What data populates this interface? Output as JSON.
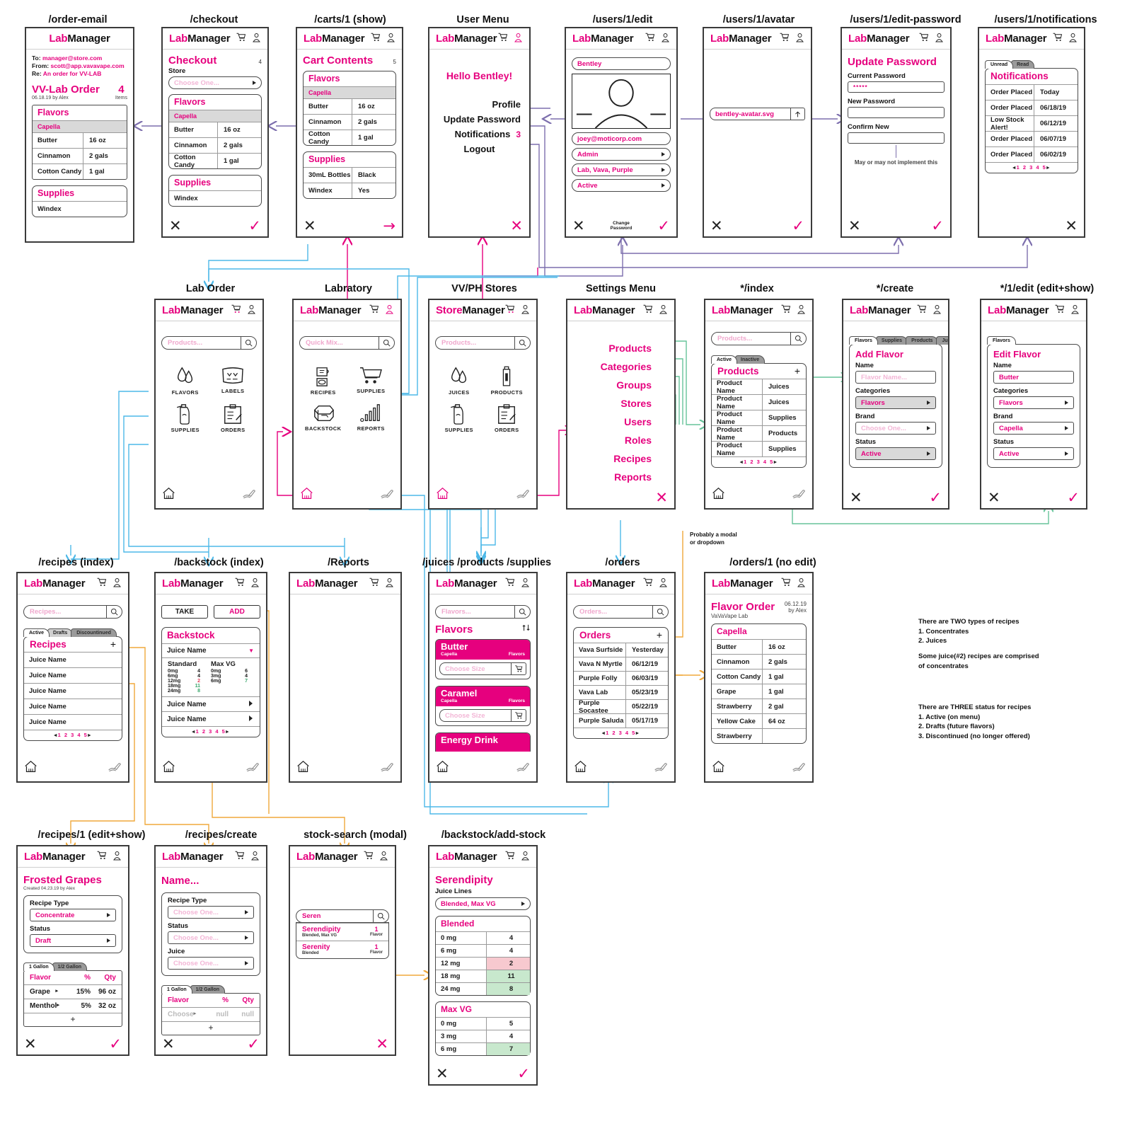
{
  "brand": {
    "pink": "Lab",
    "black": "Manager",
    "store_pink": "Store",
    "store_black": "Manager"
  },
  "colors": {
    "accent": "#e6007e",
    "ink": "#1a1a1a",
    "wire_blue": "#4db8e8",
    "wire_pink": "#e6007e",
    "wire_orange": "#f0a93b",
    "wire_purple": "#7d6fad",
    "wire_green": "#67c39a"
  },
  "screens": {
    "order_email": {
      "title": "/order-email",
      "to_label": "To:",
      "to_value": "manager@store.com",
      "from_label": "From:",
      "from_value": "scott@app.vavavape.com",
      "re_label": "Re:",
      "re_value": "An order for VV-LAB",
      "order_title": "VV-Lab Order",
      "order_count": "4",
      "order_count_label": "Items",
      "order_meta": "06.18.19 by Alex",
      "flavors_header": "Flavors",
      "brand_row": "Capella",
      "flavors": [
        {
          "name": "Butter",
          "qty": "16 oz"
        },
        {
          "name": "Cinnamon",
          "qty": "2 gals"
        },
        {
          "name": "Cotton Candy",
          "qty": "1 gal"
        }
      ],
      "supplies_header": "Supplies",
      "supplies": [
        {
          "name": "Windex",
          "qty": ""
        }
      ]
    },
    "checkout": {
      "title": "/checkout",
      "heading": "Checkout",
      "count": "4",
      "store_label": "Store",
      "store_placeholder": "Choose One...",
      "flavors_header": "Flavors",
      "brand_row": "Capella",
      "flavors": [
        {
          "name": "Butter",
          "qty": "16 oz"
        },
        {
          "name": "Cinnamon",
          "qty": "2 gals"
        },
        {
          "name": "Cotton Candy",
          "qty": "1 gal"
        }
      ],
      "supplies_header": "Supplies",
      "supplies": [
        {
          "name": "Windex",
          "qty": ""
        }
      ],
      "cancel": "✕",
      "confirm": "✓"
    },
    "cart": {
      "title": "/carts/1 (show)",
      "heading": "Cart Contents",
      "count": "5",
      "flavors_header": "Flavors",
      "brand_row": "Capella",
      "flavors": [
        {
          "name": "Butter",
          "qty": "16 oz"
        },
        {
          "name": "Cinnamon",
          "qty": "2 gals"
        },
        {
          "name": "Cotton Candy",
          "qty": "1 gal"
        }
      ],
      "supplies_header": "Supplies",
      "supplies": [
        {
          "name": "30mL Bottles",
          "qty": "Black"
        },
        {
          "name": "Windex",
          "qty": "Yes"
        }
      ],
      "cancel": "✕",
      "next": "→"
    },
    "user_menu": {
      "title": "User Menu",
      "greeting": "Hello Bentley!",
      "items": [
        {
          "label": "Profile",
          "badge": ""
        },
        {
          "label": "Update Password",
          "badge": ""
        },
        {
          "label": "Notifications",
          "badge": "3"
        },
        {
          "label": "Logout",
          "badge": ""
        }
      ],
      "close": "✕"
    },
    "user_edit": {
      "title": "/users/1/edit",
      "name": "Bentley",
      "email": "joey@moticorp.com",
      "role": "Admin",
      "stores": "Lab, Vava, Purple",
      "status": "Active",
      "change_password": "Change\nPassword",
      "cancel": "✕",
      "confirm": "✓"
    },
    "user_avatar": {
      "title": "/users/1/avatar",
      "file": "bentley-avatar.svg",
      "upload_icon": "upload-icon",
      "cancel": "✕",
      "confirm": "✓"
    },
    "edit_password": {
      "title": "/users/1/edit-password",
      "heading": "Update Password",
      "current_label": "Current Password",
      "current_value": "*****",
      "new_label": "New Password",
      "new_value": "",
      "confirm_label": "Confirm New",
      "confirm_value": "",
      "note": "May or may not implement this",
      "cancel": "✕",
      "confirm": "✓"
    },
    "notifications": {
      "title": "/users/1/notifications",
      "tabs": [
        {
          "label": "Unread",
          "active": true
        },
        {
          "label": "Read",
          "active": false
        }
      ],
      "heading": "Notifications",
      "rows": [
        {
          "text": "Order Placed",
          "date": "Today"
        },
        {
          "text": "Order Placed",
          "date": "06/18/19"
        },
        {
          "text": "Low Stock Alert!",
          "date": "06/12/19"
        },
        {
          "text": "Order Placed",
          "date": "06/07/19"
        },
        {
          "text": "Order Placed",
          "date": "06/02/19"
        }
      ],
      "pager": "1 2 3 4 5",
      "close": "✕"
    },
    "lab_order": {
      "title": "Lab Order",
      "search_placeholder": "Products...",
      "tiles": [
        {
          "label": "FLAVORS",
          "icon": "droplets-icon"
        },
        {
          "label": "LABELS",
          "icon": "label-icon"
        },
        {
          "label": "SUPPLIES",
          "icon": "spray-bottle-icon"
        },
        {
          "label": "ORDERS",
          "icon": "clipboard-icon"
        }
      ],
      "home_icon": "home-icon",
      "tools_icon": "tools-icon"
    },
    "labratory": {
      "title": "Labratory",
      "search_placeholder": "Quick Mix...",
      "tiles": [
        {
          "label": "RECIPES",
          "icon": "beaker-icon"
        },
        {
          "label": "SUPPLIES",
          "icon": "cart-icon"
        },
        {
          "label": "BACKSTOCK",
          "icon": "box-icon"
        },
        {
          "label": "REPORTS",
          "icon": "bars-icon"
        }
      ],
      "home_icon": "home-icon",
      "tools_icon": "tools-icon"
    },
    "stores": {
      "title": "VV/PH Stores",
      "search_placeholder": "Products...",
      "tiles": [
        {
          "label": "JUICES",
          "icon": "droplets-icon"
        },
        {
          "label": "PRODUCTS",
          "icon": "bottle-icon"
        },
        {
          "label": "SUPPLIES",
          "icon": "spray-bottle-icon"
        },
        {
          "label": "ORDERS",
          "icon": "clipboard-icon"
        }
      ],
      "home_icon": "home-icon",
      "tools_icon": "tools-icon"
    },
    "settings_menu": {
      "title": "Settings Menu",
      "items": [
        "Products",
        "Categories",
        "Groups",
        "Stores",
        "Users",
        "Roles",
        "Recipes",
        "Reports"
      ],
      "close": "✕"
    },
    "index": {
      "title": "*/index",
      "search_placeholder": "Products...",
      "tabs": [
        {
          "label": "Active",
          "active": true
        },
        {
          "label": "Inactive",
          "active": false
        }
      ],
      "heading": "Products",
      "add": "+",
      "rows": [
        {
          "name": "Product Name",
          "cat": "Juices"
        },
        {
          "name": "Product Name",
          "cat": "Juices"
        },
        {
          "name": "Product Name",
          "cat": "Supplies"
        },
        {
          "name": "Product Name",
          "cat": "Products"
        },
        {
          "name": "Product Name",
          "cat": "Supplies"
        }
      ],
      "pager": "1 2 3 4 5",
      "home_icon": "home-icon",
      "tools_icon": "tools-icon"
    },
    "create": {
      "title": "*/create",
      "tabs": [
        {
          "label": "Flavors",
          "active": true
        },
        {
          "label": "Supplies",
          "active": false
        },
        {
          "label": "Products",
          "active": false
        },
        {
          "label": "Juices",
          "active": false
        }
      ],
      "heading": "Add Flavor",
      "fields": [
        {
          "label": "Name",
          "value": "",
          "placeholder": "Flavor Name...",
          "select": false
        },
        {
          "label": "Categories",
          "value": "Flavors",
          "placeholder": "",
          "select": true
        },
        {
          "label": "Brand",
          "value": "",
          "placeholder": "Choose One...",
          "select": true
        },
        {
          "label": "Status",
          "value": "Active",
          "placeholder": "",
          "select": true
        }
      ],
      "cancel": "✕",
      "confirm": "✓"
    },
    "edit": {
      "title": "*/1/edit (edit+show)",
      "tabs": [
        {
          "label": "Flavors",
          "active": true
        }
      ],
      "heading": "Edit Flavor",
      "fields": [
        {
          "label": "Name",
          "value": "Butter",
          "placeholder": "",
          "select": false
        },
        {
          "label": "Categories",
          "value": "Flavors",
          "placeholder": "",
          "select": true
        },
        {
          "label": "Brand",
          "value": "Capella",
          "placeholder": "",
          "select": true
        },
        {
          "label": "Status",
          "value": "Active",
          "placeholder": "",
          "select": true
        }
      ],
      "cancel": "✕",
      "confirm": "✓"
    },
    "recipes_index": {
      "title": "/recipes (index)",
      "search_placeholder": "Recipes...",
      "tabs": [
        {
          "label": "Active",
          "active": true
        },
        {
          "label": "Drafts",
          "active": false
        },
        {
          "label": "Discountinued",
          "active": false
        }
      ],
      "heading": "Recipes",
      "add": "+",
      "rows": [
        "Juice Name",
        "Juice Name",
        "Juice Name",
        "Juice Name",
        "Juice Name"
      ],
      "pager": "1 2 3 4 5",
      "home_icon": "home-icon",
      "tools_icon": "tools-icon"
    },
    "backstock_index": {
      "title": "/backstock (index)",
      "take": "TAKE",
      "add": "ADD",
      "heading": "Backstock",
      "open_row": "Juice Name",
      "col1_header": "Standard",
      "col2_header": "Max VG",
      "standard": [
        {
          "mg": "0mg",
          "qty": "4",
          "color": "dark"
        },
        {
          "mg": "6mg",
          "qty": "4",
          "color": "dark"
        },
        {
          "mg": "12mg",
          "qty": "2",
          "color": "red"
        },
        {
          "mg": "18mg",
          "qty": "11",
          "color": "green"
        },
        {
          "mg": "24mg",
          "qty": "8",
          "color": "green"
        }
      ],
      "maxvg": [
        {
          "mg": "0mg",
          "qty": "6",
          "color": "dark"
        },
        {
          "mg": "3mg",
          "qty": "4",
          "color": "dark"
        },
        {
          "mg": "6mg",
          "qty": "7",
          "color": "green"
        }
      ],
      "rows": [
        "Juice Name",
        "Juice Name"
      ],
      "pager": "1 2 3 4 5",
      "home_icon": "home-icon",
      "tools_icon": "tools-icon"
    },
    "reports": {
      "title": "/Reports",
      "home_icon": "home-icon",
      "tools_icon": "tools-icon"
    },
    "juices": {
      "title": "/juices /products /supplies",
      "search_placeholder": "Flavors...",
      "heading": "Flavors",
      "sort_icon": "sort-icon",
      "cards": [
        {
          "name": "Butter",
          "brand": "Capella",
          "cat": "Flavors",
          "size_placeholder": "Choose Size"
        },
        {
          "name": "Caramel",
          "brand": "Capella",
          "cat": "Flavors",
          "size_placeholder": "Choose Size"
        },
        {
          "name": "Energy Drink",
          "brand": "",
          "cat": "",
          "size_placeholder": ""
        }
      ],
      "home_icon": "home-icon",
      "tools_icon": "tools-icon"
    },
    "orders": {
      "title": "/orders",
      "search_placeholder": "Orders...",
      "heading": "Orders",
      "add": "+",
      "rows": [
        {
          "name": "Vava Surfside",
          "date": "Yesterday"
        },
        {
          "name": "Vava N Myrtle",
          "date": "06/12/19"
        },
        {
          "name": "Purple Folly",
          "date": "06/03/19"
        },
        {
          "name": "Vava Lab",
          "date": "05/23/19"
        },
        {
          "name": "Purple Socastee",
          "date": "05/22/19"
        },
        {
          "name": "Purple Saluda",
          "date": "05/17/19"
        }
      ],
      "pager": "1 2 3 4 5",
      "home_icon": "home-icon",
      "tools_icon": "tools-icon"
    },
    "order_show": {
      "title": "/orders/1 (no edit)",
      "heading": "Flavor Order",
      "sub": "VaVaVape Lab",
      "date": "06.12.19",
      "by": "by Alex",
      "brand_row": "Capella",
      "rows": [
        {
          "name": "Butter",
          "qty": "16 oz"
        },
        {
          "name": "Cinnamon",
          "qty": "2 gals"
        },
        {
          "name": "Cotton Candy",
          "qty": "1 gal"
        },
        {
          "name": "Grape",
          "qty": "1 gal"
        },
        {
          "name": "Strawberry",
          "qty": "2 gal"
        },
        {
          "name": "Yellow Cake",
          "qty": "64 oz"
        },
        {
          "name": "Strawberry",
          "qty": ""
        }
      ],
      "home_icon": "home-icon",
      "tools_icon": "tools-icon"
    },
    "recipe_edit": {
      "title": "/recipes/1 (edit+show)",
      "heading": "Frosted Grapes",
      "meta": "Created 04.23.19 by Alex",
      "type_label": "Recipe Type",
      "type_value": "Concentrate",
      "status_label": "Status",
      "status_value": "Draft",
      "tabs": [
        {
          "label": "1 Gallon",
          "active": true
        },
        {
          "label": "1/2 Gallon",
          "active": false
        }
      ],
      "cols": [
        "Flavor",
        "%",
        "Qty"
      ],
      "rows": [
        {
          "flavor": "Grape",
          "pct": "15%",
          "qty": "96 oz"
        },
        {
          "flavor": "Menthol",
          "pct": "5%",
          "qty": "32 oz"
        }
      ],
      "add": "+",
      "cancel": "✕",
      "confirm": "✓"
    },
    "recipe_create": {
      "title": "/recipes/create",
      "heading": "Name...",
      "fields": [
        {
          "label": "Recipe Type",
          "placeholder": "Choose One..."
        },
        {
          "label": "Status",
          "placeholder": "Choose One..."
        },
        {
          "label": "Juice",
          "placeholder": "Choose One..."
        }
      ],
      "tabs": [
        {
          "label": "1 Gallon",
          "active": true
        },
        {
          "label": "1/2 Gallon",
          "active": false
        }
      ],
      "cols": [
        "Flavor",
        "%",
        "Qty"
      ],
      "rows": [
        {
          "flavor": "Choose",
          "pct": "null",
          "qty": "null"
        }
      ],
      "add": "+",
      "cancel": "✕",
      "confirm": "✓"
    },
    "stock_search": {
      "title": "stock-search (modal)",
      "query": "Seren",
      "results": [
        {
          "name": "Serendipity",
          "sub": "Blended, Max VG",
          "count": "1",
          "count_label": "Flavor"
        },
        {
          "name": "Serenity",
          "sub": "Blended",
          "count": "1",
          "count_label": "Flavor"
        }
      ],
      "close": "✕"
    },
    "add_stock": {
      "title": "/backstock/add-stock",
      "heading": "Serendipity",
      "lines_label": "Juice Lines",
      "lines_value": "Blended, Max VG",
      "groups": [
        {
          "name": "Blended",
          "rows": [
            {
              "mg": "0 mg",
              "qty": "4",
              "hl": "none"
            },
            {
              "mg": "6 mg",
              "qty": "4",
              "hl": "none"
            },
            {
              "mg": "12 mg",
              "qty": "2",
              "hl": "red"
            },
            {
              "mg": "18 mg",
              "qty": "11",
              "hl": "green"
            },
            {
              "mg": "24 mg",
              "qty": "8",
              "hl": "green"
            }
          ]
        },
        {
          "name": "Max VG",
          "rows": [
            {
              "mg": "0 mg",
              "qty": "5",
              "hl": "none"
            },
            {
              "mg": "3 mg",
              "qty": "4",
              "hl": "none"
            },
            {
              "mg": "6 mg",
              "qty": "7",
              "hl": "green"
            }
          ]
        }
      ],
      "cancel": "✕",
      "confirm": "✓"
    }
  },
  "annotations": {
    "modal_note": "Probably a modal\nor dropdown",
    "notes_block_1": "There are TWO types of recipes\n1. Concentrates\n2. Juices",
    "notes_block_2": "Some juice(#2) recipes are comprised\nof concentrates",
    "notes_block_3": "There are THREE status for recipes\n1. Active (on menu)\n2. Drafts (future flavors)\n3. Discontinued (no longer offered)"
  }
}
